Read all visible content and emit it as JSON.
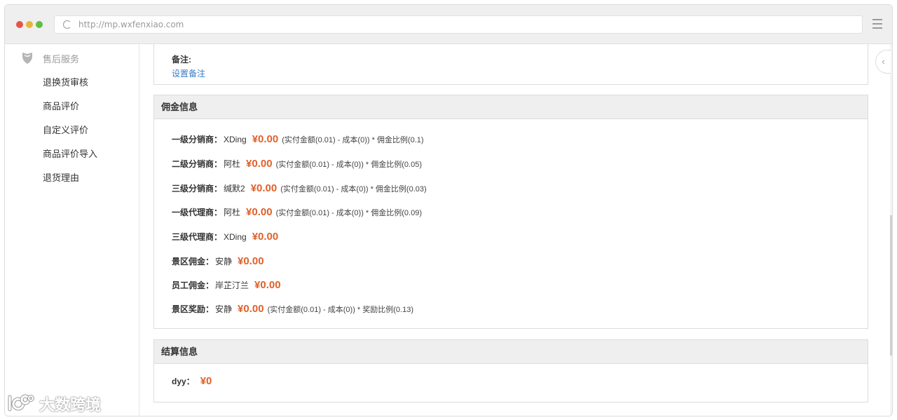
{
  "browser": {
    "url": "http://mp.wxfenxiao.com"
  },
  "sidebar": {
    "section_title": "售后服务",
    "items": [
      {
        "label": "退换货审核"
      },
      {
        "label": "商品评价"
      },
      {
        "label": "自定义评价"
      },
      {
        "label": "商品评价导入"
      },
      {
        "label": "退货理由"
      }
    ]
  },
  "note_panel": {
    "label": "备注:",
    "link": "设置备注"
  },
  "commission_panel": {
    "title": "佣金信息",
    "rows": [
      {
        "label": "一级分销商：",
        "name": "XDing",
        "amount": "¥0.00",
        "formula": "(实付金额(0.01) - 成本(0)) * 佣金比例(0.1)"
      },
      {
        "label": "二级分销商：",
        "name": "阿杜",
        "amount": "¥0.00",
        "formula": "(实付金额(0.01) - 成本(0)) * 佣金比例(0.05)"
      },
      {
        "label": "三级分销商：",
        "name": "缄默2",
        "amount": "¥0.00",
        "formula": "(实付金额(0.01) - 成本(0)) * 佣金比例(0.03)"
      },
      {
        "label": "一级代理商：",
        "name": "阿杜",
        "amount": "¥0.00",
        "formula": "(实付金额(0.01) - 成本(0)) * 佣金比例(0.09)"
      },
      {
        "label": "三级代理商：",
        "name": "XDing",
        "amount": "¥0.00",
        "formula": ""
      },
      {
        "label": "景区佣金：",
        "name": "安静",
        "amount": "¥0.00",
        "formula": ""
      },
      {
        "label": "员工佣金：",
        "name": "岸芷汀兰",
        "amount": "¥0.00",
        "formula": ""
      },
      {
        "label": "景区奖励：",
        "name": "安静",
        "amount": "¥0.00",
        "formula": "(实付金额(0.01) - 成本(0)) * 奖励比例(0.13)"
      }
    ]
  },
  "settlement_panel": {
    "title": "结算信息",
    "rows": [
      {
        "label": "dyy：",
        "amount": "¥0"
      }
    ]
  },
  "watermark": {
    "text": "大数跨境"
  },
  "colors": {
    "amount": "#e0612a",
    "link": "#3a7cc7",
    "panel_header_bg": "#efefef"
  }
}
